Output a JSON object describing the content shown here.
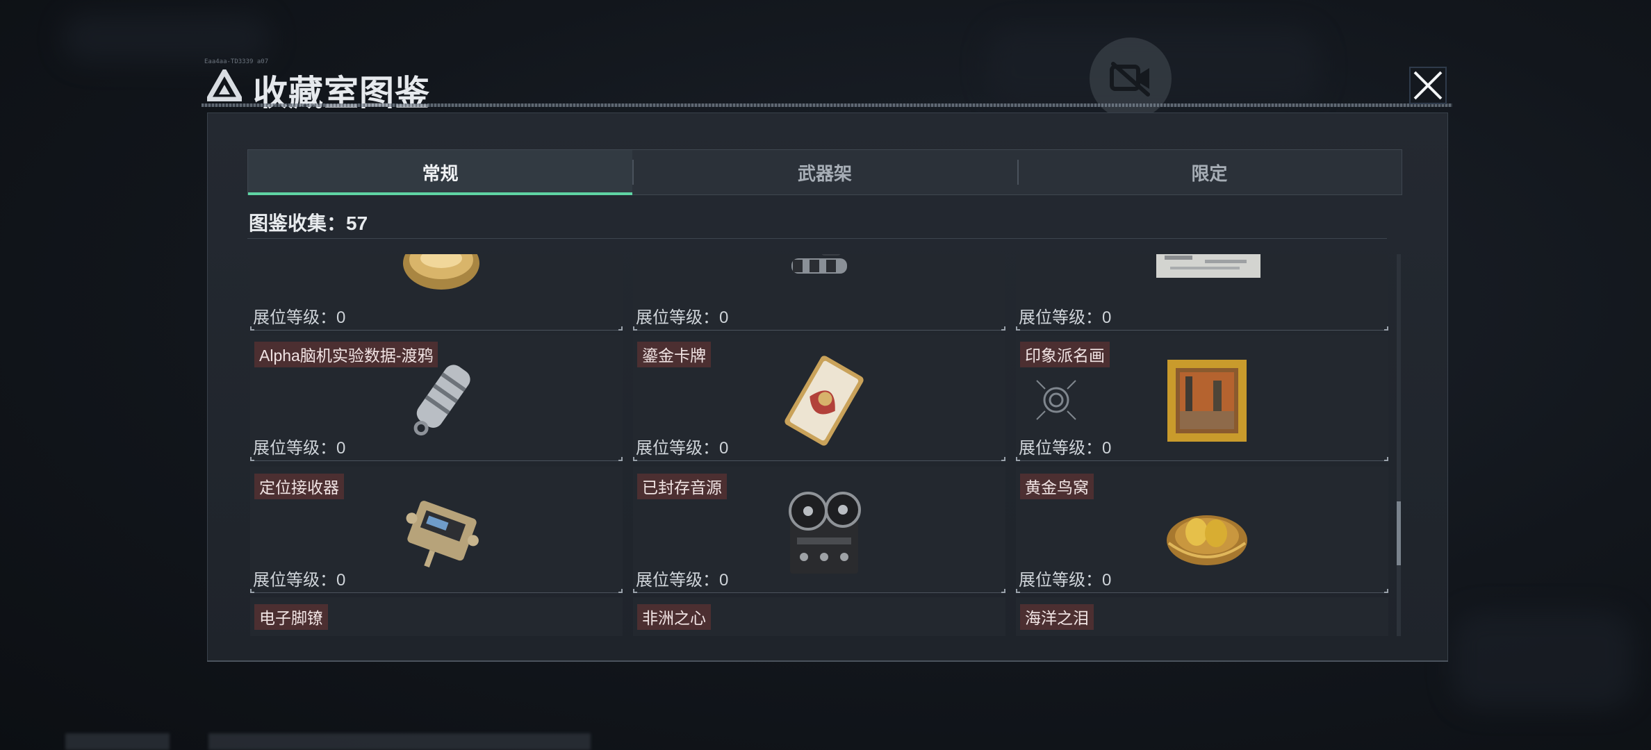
{
  "window": {
    "title": "收藏室图鉴",
    "title_tag": "Eaa4aa-TD3339 a07"
  },
  "tabs": [
    {
      "label": "常规",
      "active": true
    },
    {
      "label": "武器架",
      "active": false
    },
    {
      "label": "限定",
      "active": false
    }
  ],
  "collection": {
    "label": "图鉴收集：57"
  },
  "level_label": "展位等级：0",
  "items": [
    {
      "name": "",
      "icon": "gold-bowl-icon"
    },
    {
      "name": "",
      "icon": "dumbbell-device-icon"
    },
    {
      "name": "",
      "icon": "paper-document-icon"
    },
    {
      "name": "Alpha脑机实验数据-渡鸦",
      "icon": "data-capsule-icon"
    },
    {
      "name": "鎏金卡牌",
      "icon": "gilded-card-icon"
    },
    {
      "name": "印象派名画",
      "icon": "framed-painting-icon"
    },
    {
      "name": "定位接收器",
      "icon": "locator-receiver-icon"
    },
    {
      "name": "已封存音源",
      "icon": "reel-recorder-icon"
    },
    {
      "name": "黄金鸟窝",
      "icon": "golden-nest-icon"
    },
    {
      "name": "电子脚镣",
      "icon": "electronic-ankle-monitor-icon"
    },
    {
      "name": "非洲之心",
      "icon": "diamond-icon"
    },
    {
      "name": "海洋之泪",
      "icon": "ocean-orb-icon"
    }
  ],
  "colors": {
    "accent": "#5fd4a4",
    "name_tag_bg": "#4c2f31",
    "panel_bg": "#23282f"
  }
}
